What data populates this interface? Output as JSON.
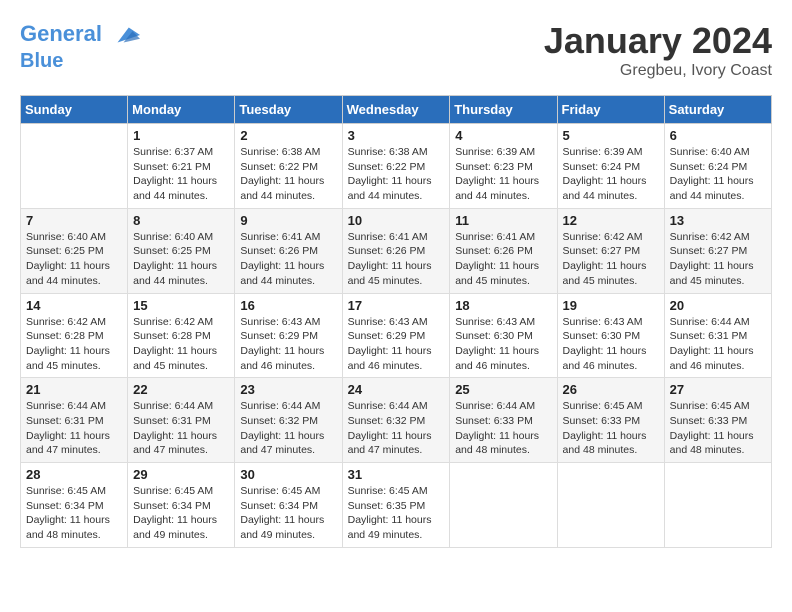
{
  "header": {
    "logo_line1": "General",
    "logo_line2": "Blue",
    "month_title": "January 2024",
    "location": "Gregbeu, Ivory Coast"
  },
  "weekdays": [
    "Sunday",
    "Monday",
    "Tuesday",
    "Wednesday",
    "Thursday",
    "Friday",
    "Saturday"
  ],
  "weeks": [
    [
      {
        "day": "",
        "detail": ""
      },
      {
        "day": "1",
        "detail": "Sunrise: 6:37 AM\nSunset: 6:21 PM\nDaylight: 11 hours\nand 44 minutes."
      },
      {
        "day": "2",
        "detail": "Sunrise: 6:38 AM\nSunset: 6:22 PM\nDaylight: 11 hours\nand 44 minutes."
      },
      {
        "day": "3",
        "detail": "Sunrise: 6:38 AM\nSunset: 6:22 PM\nDaylight: 11 hours\nand 44 minutes."
      },
      {
        "day": "4",
        "detail": "Sunrise: 6:39 AM\nSunset: 6:23 PM\nDaylight: 11 hours\nand 44 minutes."
      },
      {
        "day": "5",
        "detail": "Sunrise: 6:39 AM\nSunset: 6:24 PM\nDaylight: 11 hours\nand 44 minutes."
      },
      {
        "day": "6",
        "detail": "Sunrise: 6:40 AM\nSunset: 6:24 PM\nDaylight: 11 hours\nand 44 minutes."
      }
    ],
    [
      {
        "day": "7",
        "detail": "Sunrise: 6:40 AM\nSunset: 6:25 PM\nDaylight: 11 hours\nand 44 minutes."
      },
      {
        "day": "8",
        "detail": "Sunrise: 6:40 AM\nSunset: 6:25 PM\nDaylight: 11 hours\nand 44 minutes."
      },
      {
        "day": "9",
        "detail": "Sunrise: 6:41 AM\nSunset: 6:26 PM\nDaylight: 11 hours\nand 44 minutes."
      },
      {
        "day": "10",
        "detail": "Sunrise: 6:41 AM\nSunset: 6:26 PM\nDaylight: 11 hours\nand 45 minutes."
      },
      {
        "day": "11",
        "detail": "Sunrise: 6:41 AM\nSunset: 6:26 PM\nDaylight: 11 hours\nand 45 minutes."
      },
      {
        "day": "12",
        "detail": "Sunrise: 6:42 AM\nSunset: 6:27 PM\nDaylight: 11 hours\nand 45 minutes."
      },
      {
        "day": "13",
        "detail": "Sunrise: 6:42 AM\nSunset: 6:27 PM\nDaylight: 11 hours\nand 45 minutes."
      }
    ],
    [
      {
        "day": "14",
        "detail": "Sunrise: 6:42 AM\nSunset: 6:28 PM\nDaylight: 11 hours\nand 45 minutes."
      },
      {
        "day": "15",
        "detail": "Sunrise: 6:42 AM\nSunset: 6:28 PM\nDaylight: 11 hours\nand 45 minutes."
      },
      {
        "day": "16",
        "detail": "Sunrise: 6:43 AM\nSunset: 6:29 PM\nDaylight: 11 hours\nand 46 minutes."
      },
      {
        "day": "17",
        "detail": "Sunrise: 6:43 AM\nSunset: 6:29 PM\nDaylight: 11 hours\nand 46 minutes."
      },
      {
        "day": "18",
        "detail": "Sunrise: 6:43 AM\nSunset: 6:30 PM\nDaylight: 11 hours\nand 46 minutes."
      },
      {
        "day": "19",
        "detail": "Sunrise: 6:43 AM\nSunset: 6:30 PM\nDaylight: 11 hours\nand 46 minutes."
      },
      {
        "day": "20",
        "detail": "Sunrise: 6:44 AM\nSunset: 6:31 PM\nDaylight: 11 hours\nand 46 minutes."
      }
    ],
    [
      {
        "day": "21",
        "detail": "Sunrise: 6:44 AM\nSunset: 6:31 PM\nDaylight: 11 hours\nand 47 minutes."
      },
      {
        "day": "22",
        "detail": "Sunrise: 6:44 AM\nSunset: 6:31 PM\nDaylight: 11 hours\nand 47 minutes."
      },
      {
        "day": "23",
        "detail": "Sunrise: 6:44 AM\nSunset: 6:32 PM\nDaylight: 11 hours\nand 47 minutes."
      },
      {
        "day": "24",
        "detail": "Sunrise: 6:44 AM\nSunset: 6:32 PM\nDaylight: 11 hours\nand 47 minutes."
      },
      {
        "day": "25",
        "detail": "Sunrise: 6:44 AM\nSunset: 6:33 PM\nDaylight: 11 hours\nand 48 minutes."
      },
      {
        "day": "26",
        "detail": "Sunrise: 6:45 AM\nSunset: 6:33 PM\nDaylight: 11 hours\nand 48 minutes."
      },
      {
        "day": "27",
        "detail": "Sunrise: 6:45 AM\nSunset: 6:33 PM\nDaylight: 11 hours\nand 48 minutes."
      }
    ],
    [
      {
        "day": "28",
        "detail": "Sunrise: 6:45 AM\nSunset: 6:34 PM\nDaylight: 11 hours\nand 48 minutes."
      },
      {
        "day": "29",
        "detail": "Sunrise: 6:45 AM\nSunset: 6:34 PM\nDaylight: 11 hours\nand 49 minutes."
      },
      {
        "day": "30",
        "detail": "Sunrise: 6:45 AM\nSunset: 6:34 PM\nDaylight: 11 hours\nand 49 minutes."
      },
      {
        "day": "31",
        "detail": "Sunrise: 6:45 AM\nSunset: 6:35 PM\nDaylight: 11 hours\nand 49 minutes."
      },
      {
        "day": "",
        "detail": ""
      },
      {
        "day": "",
        "detail": ""
      },
      {
        "day": "",
        "detail": ""
      }
    ]
  ]
}
